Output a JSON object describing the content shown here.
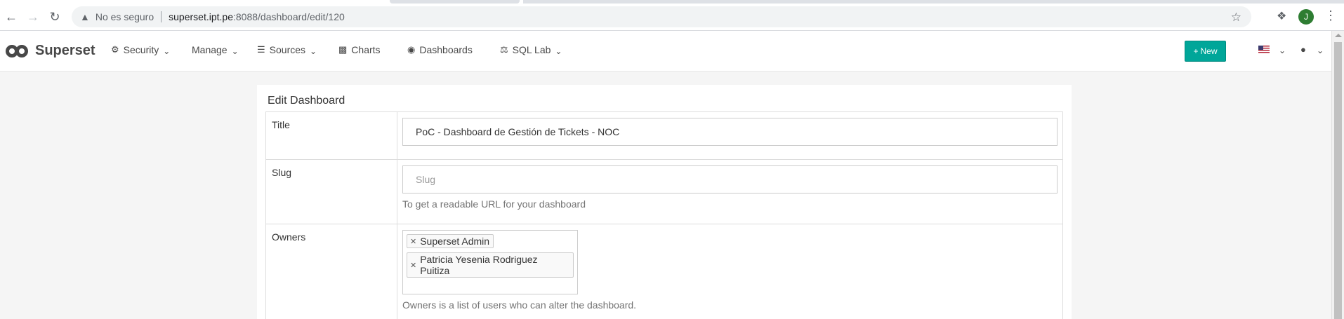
{
  "browser": {
    "back_icon": "arrow-left-icon",
    "forward_icon": "arrow-right-icon",
    "reload_icon": "reload-icon",
    "security_warning": "No es seguro",
    "url_host": "superset.ipt.pe",
    "url_path": ":8088/dashboard/edit/120",
    "profile_initial": "J"
  },
  "navbar": {
    "brand": "Superset",
    "items": [
      {
        "label": "Security",
        "icon": "cogs-icon",
        "has_caret": true
      },
      {
        "label": "Manage",
        "icon": "",
        "has_caret": true
      },
      {
        "label": "Sources",
        "icon": "database-icon",
        "has_caret": true
      },
      {
        "label": "Charts",
        "icon": "bar-chart-icon",
        "has_caret": false
      },
      {
        "label": "Dashboards",
        "icon": "dashboard-icon",
        "has_caret": false
      },
      {
        "label": "SQL Lab",
        "icon": "flask-icon",
        "has_caret": true
      }
    ],
    "new_button": "New",
    "accent_color": "#00a699"
  },
  "form": {
    "heading": "Edit Dashboard",
    "title_label": "Title",
    "title_value": "PoC - Dashboard de Gestión de Tickets - NOC",
    "slug_label": "Slug",
    "slug_placeholder": "Slug",
    "slug_help": "To get a readable URL for your dashboard",
    "owners_label": "Owners",
    "owners": [
      "Superset Admin",
      "Patricia Yesenia Rodriguez Puitiza"
    ],
    "owners_help": "Owners is a list of users who can alter the dashboard."
  }
}
